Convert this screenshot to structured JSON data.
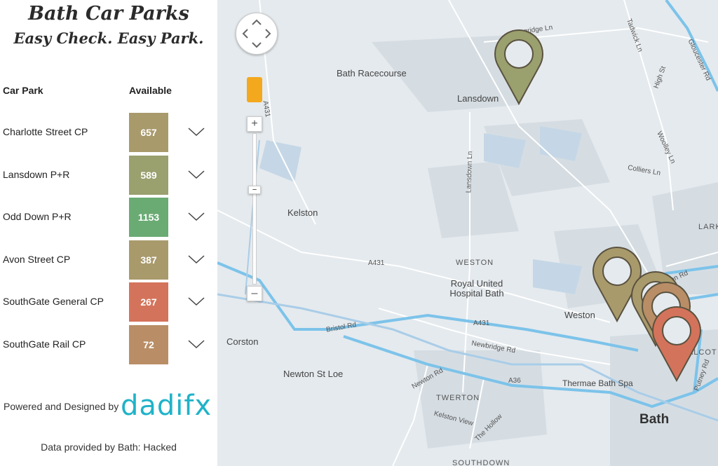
{
  "header": {
    "title": "Bath Car Parks",
    "tagline": "Easy Check. Easy Park."
  },
  "table": {
    "col_name": "Car Park",
    "col_available": "Available",
    "rows": [
      {
        "name": "Charlotte Street CP",
        "available": "657",
        "color": "#a99a6c"
      },
      {
        "name": "Lansdown P+R",
        "available": "589",
        "color": "#9aa06e"
      },
      {
        "name": "Odd Down P+R",
        "available": "1153",
        "color": "#6aab74"
      },
      {
        "name": "Avon Street CP",
        "available": "387",
        "color": "#a99a6c"
      },
      {
        "name": "SouthGate General CP",
        "available": "267",
        "color": "#d4735b"
      },
      {
        "name": "SouthGate Rail CP",
        "available": "72",
        "color": "#b98e66"
      }
    ]
  },
  "footer": {
    "powered": "Powered and Designed by",
    "logo": "dadifx",
    "credit": "Data provided by Bath: Hacked"
  },
  "map": {
    "labels": [
      "Langridge Ln",
      "Tadwick Ln",
      "Gloucester Rd",
      "High St",
      "Bath Racecourse",
      "Lansdown",
      "Lansdown Ln",
      "Woolley Ln",
      "Colliers Ln",
      "Kelston",
      "A431",
      "WESTON",
      "Royal United Hospital Bath",
      "Camden Rd",
      "Weston",
      "A431",
      "Bristol Rd",
      "Corston",
      "Newbridge Rd",
      "Newton St Loe",
      "Newton Rd",
      "A36",
      "Thermae Bath Spa",
      "TWERTON",
      "Kelston View",
      "The Hollow",
      "SOUTHDOWN",
      "Bath",
      "LARK",
      "Putney Rd",
      "A431",
      "WALCOT"
    ],
    "markers": [
      {
        "color": "#9aa06e"
      },
      {
        "color": "#a99a6c"
      },
      {
        "color": "#a99a6c"
      },
      {
        "color": "#b98e66"
      },
      {
        "color": "#d4735b"
      }
    ]
  }
}
